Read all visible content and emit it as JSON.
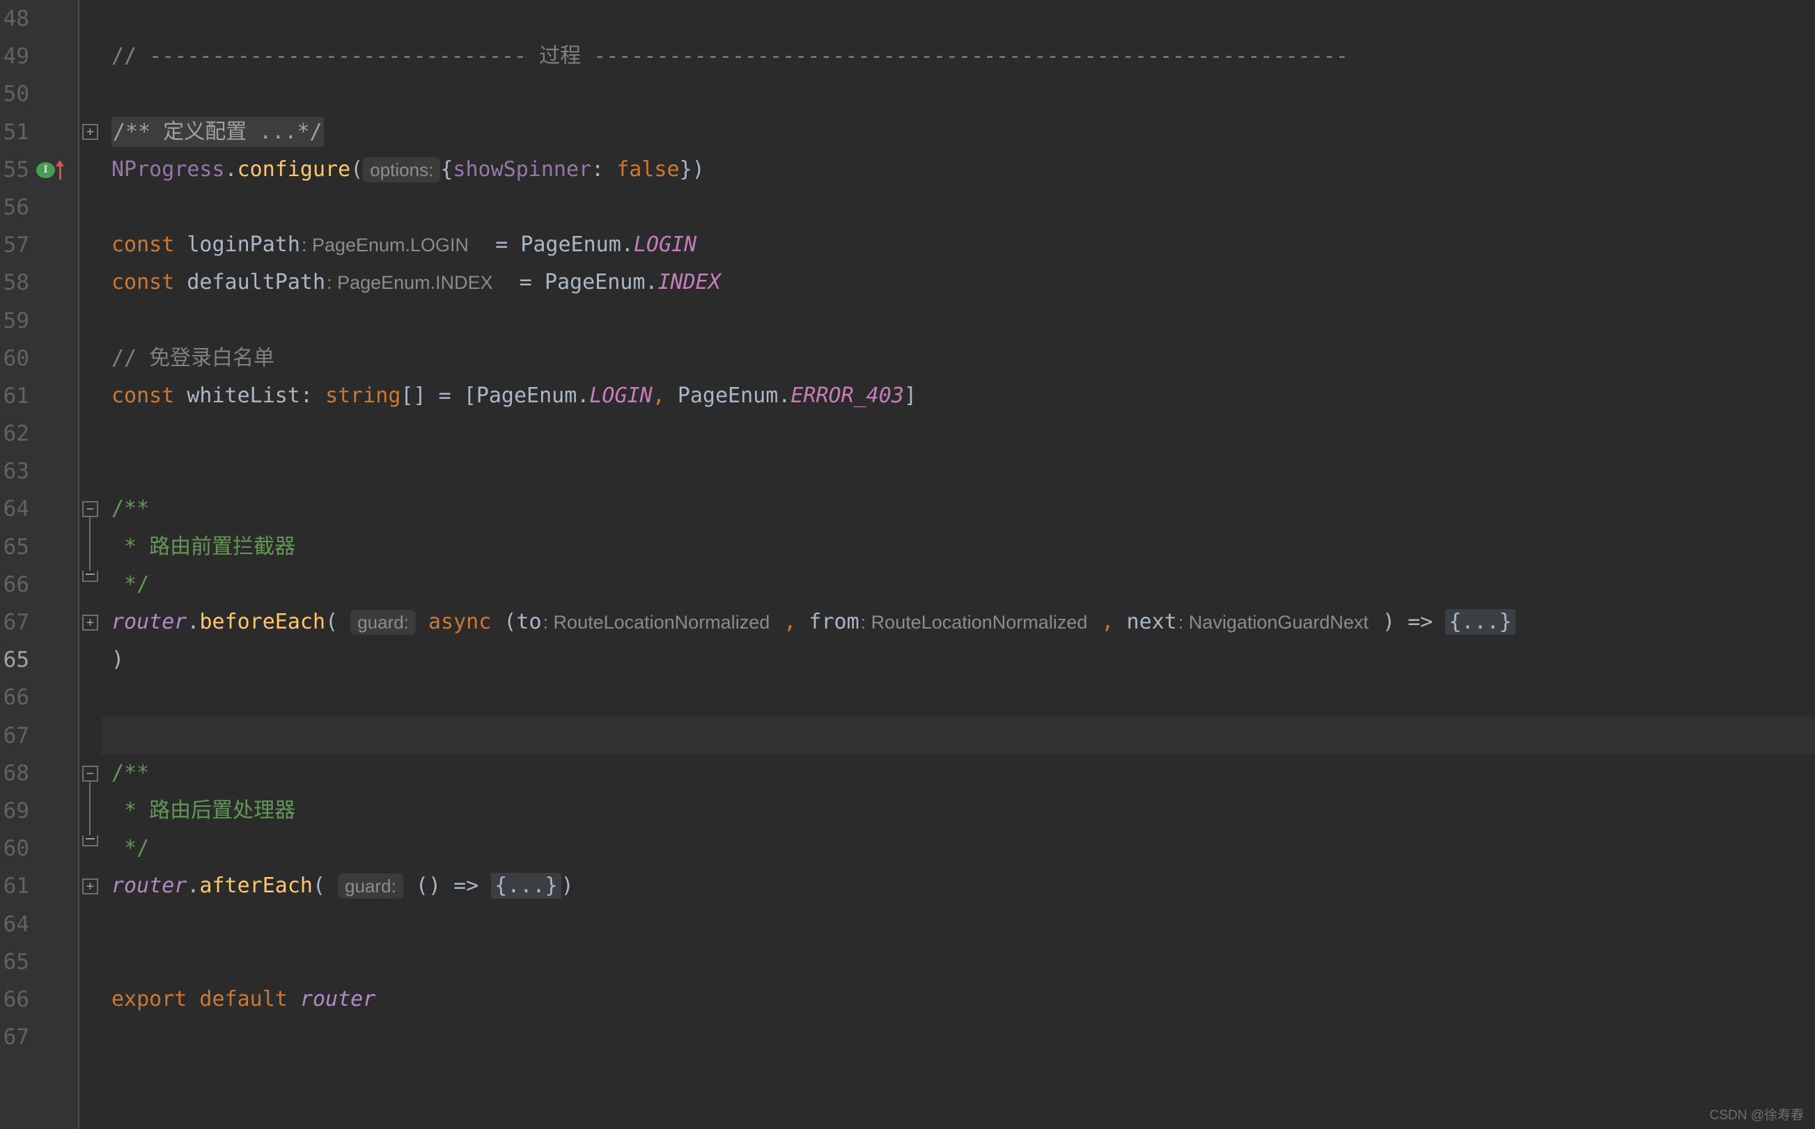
{
  "editor": {
    "theme_name": "darcula",
    "background": "#2b2b2b",
    "gutter_background": "#313335",
    "current_line_background": "#323232"
  },
  "gutter": {
    "line_numbers": [
      "48",
      "49",
      "50",
      "51",
      "55",
      "56",
      "57",
      "58",
      "59",
      "60",
      "61",
      "62",
      "63",
      "64",
      "65",
      "66",
      "67",
      "65",
      "66",
      "67",
      "68",
      "69",
      "60",
      "61",
      "64",
      "65",
      "66",
      "67"
    ],
    "run_marker": {
      "icon": "run-gutter-icon",
      "glyph": "I",
      "color": "#499c54",
      "arrow_color": "#d9544f",
      "line_index": 4
    },
    "fold_markers": [
      {
        "type": "fold-expand-icon",
        "glyph": "+",
        "line_index": 3
      },
      {
        "type": "fold-collapse-icon",
        "glyph": "−",
        "line_index": 13
      },
      {
        "type": "fold-end-icon",
        "glyph": "",
        "line_index": 15
      },
      {
        "type": "fold-expand-icon",
        "glyph": "+",
        "line_index": 16
      },
      {
        "type": "fold-collapse-icon",
        "glyph": "−",
        "line_index": 20
      },
      {
        "type": "fold-end-icon",
        "glyph": "",
        "line_index": 22
      },
      {
        "type": "fold-expand-icon",
        "glyph": "+",
        "line_index": 23
      }
    ]
  },
  "code": {
    "section_divider_comment": {
      "slashes": "// ",
      "left_dashes": "------------------------------",
      "label": " 过程 ",
      "right_dashes": "------------------------------------------------------------"
    },
    "lines": {
      "folded_doc_comment": "/** 定义配置 ...*/",
      "nprogress_obj": "NProgress",
      "nprogress_dot": ".",
      "nprogress_fn": "configure",
      "nprogress_open": "(",
      "nprogress_hint": "options:",
      "nprogress_brace_open": "{",
      "nprogress_key": "showSpinner",
      "nprogress_colon": ": ",
      "nprogress_value": "false",
      "nprogress_close": "})",
      "const_kw": "const",
      "loginpath_name": "loginPath",
      "loginpath_type_hint": ": PageEnum.LOGIN",
      "loginpath_eq": "  = ",
      "loginpath_enum": "PageEnum.",
      "loginpath_member": "LOGIN",
      "defaultpath_name": "defaultPath",
      "defaultpath_type_hint": ": PageEnum.INDEX",
      "defaultpath_eq": "  = ",
      "defaultpath_enum": "PageEnum.",
      "defaultpath_member": "INDEX",
      "whitelist_comment": "// 免登录白名单",
      "whitelist_name": "whiteList",
      "whitelist_colon": ": ",
      "whitelist_type": "string",
      "whitelist_brackets": "[] ",
      "whitelist_eq": "= [",
      "whitelist_enum1": "PageEnum.",
      "whitelist_member1": "LOGIN",
      "whitelist_sep": ", ",
      "whitelist_enum2": "PageEnum.",
      "whitelist_member2": "ERROR_403",
      "whitelist_close": "]",
      "doc_open": "/**",
      "doc_before_each_text": " * 路由前置拦截器",
      "doc_after_each_text": " * 路由后置处理器",
      "doc_close": " */",
      "router_obj": "router",
      "before_each_dot": ".",
      "before_each_fn": "beforeEach",
      "before_each_open": "( ",
      "before_each_hint": "guard:",
      "before_each_async": " async ",
      "before_each_paren": "(",
      "before_each_p1": "to",
      "before_each_p1_type": ": RouteLocationNormalized",
      "before_each_comma1": " , ",
      "before_each_p2": "from",
      "before_each_p2_type": ": RouteLocationNormalized",
      "before_each_comma2": " , ",
      "before_each_p3": "next",
      "before_each_p3_type": ": NavigationGuardNext",
      "before_each_close_paren": " ) ",
      "before_each_arrow": "=> ",
      "before_each_body_folded": "{...}",
      "before_each_tail": ")",
      "after_each_dot": ".",
      "after_each_fn": "afterEach",
      "after_each_open": "( ",
      "after_each_hint": "guard:",
      "after_each_params": " () ",
      "after_each_arrow": "=> ",
      "after_each_body_folded": "{...}",
      "after_each_tail": ")",
      "export_kw": "export default",
      "export_value": "router"
    }
  },
  "watermark": {
    "text": "CSDN @徐寿春"
  }
}
